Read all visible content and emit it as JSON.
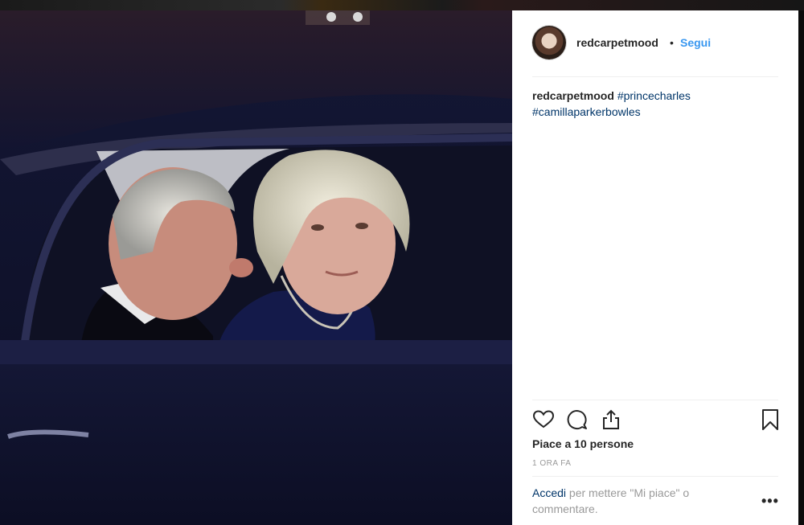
{
  "post": {
    "username": "redcarpetmood",
    "separator": "•",
    "follow_label": "Segui",
    "caption": {
      "username": "redcarpetmood",
      "hashtags": [
        "#princecharles",
        "#camillaparkerbowles"
      ]
    },
    "likes_text": "Piace a 10 persone",
    "timestamp": "1 ORA FA",
    "login_link": "Accedi",
    "login_text": "per mettere \"Mi piace\" o commentare.",
    "more_label": "•••"
  },
  "icons": {
    "like": "heart-icon",
    "comment": "comment-icon",
    "share": "share-icon",
    "save": "bookmark-icon",
    "more": "more-options-icon"
  },
  "colors": {
    "link_blue": "#3897f0",
    "hashtag_blue": "#003569",
    "text": "#262626",
    "muted": "#999999"
  }
}
